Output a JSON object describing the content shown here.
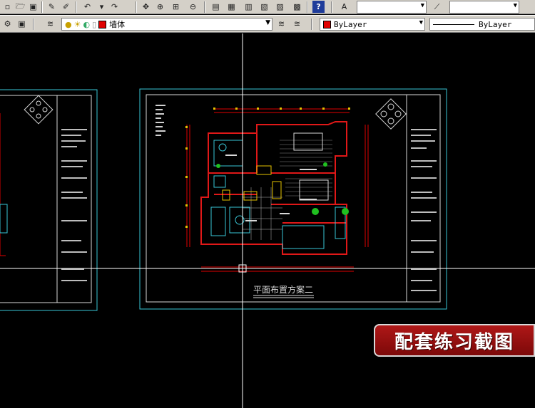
{
  "toolbar_standard": {
    "icons": [
      "new-icon",
      "open-icon",
      "save-icon",
      "print-icon",
      "plot-preview-icon",
      "publish-icon",
      "undo-icon",
      "redo-icon",
      "pan-icon",
      "zoom-realtime-icon",
      "zoom-window-icon",
      "zoom-previous-icon",
      "properties-icon",
      "design-center-icon",
      "tool-palettes-icon",
      "sheet-set-icon",
      "markup-icon",
      "calculator-icon",
      "help-icon"
    ]
  },
  "layers": {
    "current_layer": "墙体",
    "layer_color": "#e00000"
  },
  "properties": {
    "color_value": "ByLayer",
    "linetype_value": "ByLayer"
  },
  "drawing": {
    "title": "平面布置方案二"
  },
  "watermark": {
    "text": "配套练习截图"
  },
  "colors": {
    "frame": "#39c6d6",
    "wall": "#e01818",
    "dimension": "#e00000",
    "furniture": "#39c6d6",
    "text": "#e6e6e6"
  }
}
